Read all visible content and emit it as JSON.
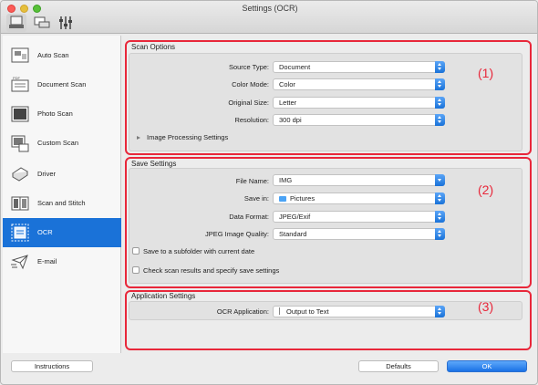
{
  "window": {
    "title": "Settings (OCR)"
  },
  "toolbar": {
    "icons": [
      "scan-from-computer-icon",
      "scan-from-operation-panel-icon",
      "general-settings-icon"
    ]
  },
  "sidebar": {
    "items": [
      {
        "label": "Auto Scan",
        "icon": "auto-scan-icon"
      },
      {
        "label": "Document Scan",
        "icon": "document-scan-icon"
      },
      {
        "label": "Photo Scan",
        "icon": "photo-scan-icon"
      },
      {
        "label": "Custom Scan",
        "icon": "custom-scan-icon"
      },
      {
        "label": "Driver",
        "icon": "driver-icon"
      },
      {
        "label": "Scan and Stitch",
        "icon": "scan-and-stitch-icon"
      },
      {
        "label": "OCR",
        "icon": "ocr-icon",
        "selected": true
      },
      {
        "label": "E-mail",
        "icon": "email-icon"
      }
    ]
  },
  "scan_options": {
    "title": "Scan Options",
    "source_type_label": "Source Type:",
    "source_type_value": "Document",
    "color_mode_label": "Color Mode:",
    "color_mode_value": "Color",
    "original_size_label": "Original Size:",
    "original_size_value": "Letter",
    "resolution_label": "Resolution:",
    "resolution_value": "300 dpi",
    "image_processing_label": "Image Processing Settings"
  },
  "save_settings": {
    "title": "Save Settings",
    "file_name_label": "File Name:",
    "file_name_value": "IMG",
    "save_in_label": "Save in:",
    "save_in_value": "Pictures",
    "data_format_label": "Data Format:",
    "data_format_value": "JPEG/Exif",
    "jpeg_quality_label": "JPEG Image Quality:",
    "jpeg_quality_value": "Standard",
    "subfolder_label": "Save to a subfolder with current date",
    "subfolder_checked": false,
    "check_results_label": "Check scan results and specify save settings",
    "check_results_checked": false
  },
  "application_settings": {
    "title": "Application Settings",
    "ocr_app_label": "OCR Application:",
    "ocr_app_value": "Output to Text"
  },
  "callouts": {
    "one": "(1)",
    "two": "(2)",
    "three": "(3)"
  },
  "footer": {
    "instructions": "Instructions",
    "defaults": "Defaults",
    "ok": "OK"
  },
  "colors": {
    "accent": "#1a72d8",
    "callout": "#e8273a"
  }
}
